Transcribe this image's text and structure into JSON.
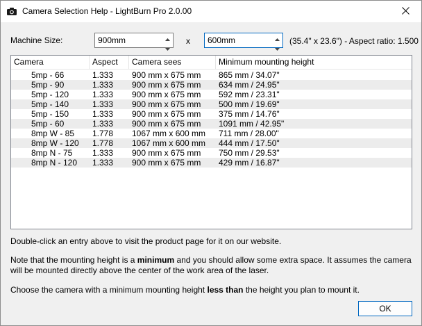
{
  "window": {
    "title": "Camera Selection Help - LightBurn Pro 2.0.00",
    "icon": "camera-icon",
    "close_icon": "close-icon"
  },
  "machine": {
    "label": "Machine Size:",
    "width_value": "900mm",
    "separator": "x",
    "height_value": "600mm",
    "dimension_info": "(35.4\" x 23.6\") - Aspect ratio: 1.500"
  },
  "table": {
    "columns": [
      "Camera",
      "Aspect",
      "Camera sees",
      "Minimum mounting height"
    ],
    "rows": [
      [
        "5mp - 66",
        "1.333",
        "900 mm x 675 mm",
        "865 mm / 34.07\""
      ],
      [
        "5mp - 90",
        "1.333",
        "900 mm x 675 mm",
        "634 mm / 24.95\""
      ],
      [
        "5mp - 120",
        "1.333",
        "900 mm x 675 mm",
        "592 mm / 23.31\""
      ],
      [
        "5mp - 140",
        "1.333",
        "900 mm x 675 mm",
        "500 mm / 19.69\""
      ],
      [
        "5mp - 150",
        "1.333",
        "900 mm x 675 mm",
        "375 mm / 14.76\""
      ],
      [
        "5mp - 60",
        "1.333",
        "900 mm x 675 mm",
        "1091 mm / 42.95\""
      ],
      [
        "8mp W - 85",
        "1.778",
        "1067 mm x 600 mm",
        "711 mm / 28.00\""
      ],
      [
        "8mp W - 120",
        "1.778",
        "1067 mm x 600 mm",
        "444 mm / 17.50\""
      ],
      [
        "8mp N - 75",
        "1.333",
        "900 mm x 675 mm",
        "750 mm / 29.53\""
      ],
      [
        "8mp N - 120",
        "1.333",
        "900 mm x 675 mm",
        "429 mm / 16.87\""
      ]
    ]
  },
  "notes": {
    "double_click": "Double-click an entry above to visit the product page for it on our website.",
    "mounting_line1_pre": "Note that the mounting height is a ",
    "mounting_line1_bold": "minimum",
    "mounting_line1_post": " and you should allow some extra space. It assumes the camera",
    "mounting_line2": "will be mounted directly above the center of the work area of the laser.",
    "choose_pre": "Choose the camera with a minimum mounting height ",
    "choose_bold": "less than",
    "choose_post": " the height you plan to mount it."
  },
  "buttons": {
    "ok_label": "OK"
  },
  "colors": {
    "accent": "#0067c0",
    "row_alt": "#ececec",
    "background": "#f0f0f0"
  }
}
